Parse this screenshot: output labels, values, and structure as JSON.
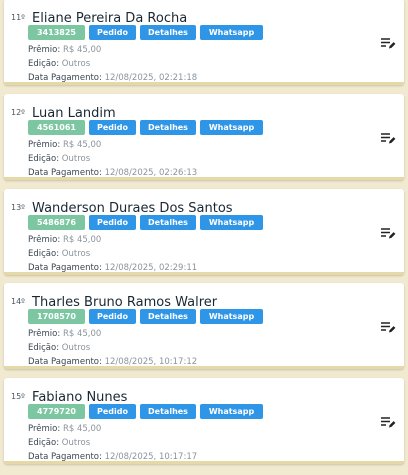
{
  "labels": {
    "premio": "Prêmio:",
    "edicao": "Edição:",
    "data_pagamento": "Data Pagamento:",
    "pedido": "Pedido",
    "detalhes": "Detalhes",
    "whatsapp": "Whatsapp"
  },
  "icons": {
    "edit": "edit-list-icon"
  },
  "colors": {
    "code_chip": "#7cc7a2",
    "button": "#2f95e6",
    "card_border": "#e6d9a8"
  },
  "winners": [
    {
      "position": "11º",
      "name": "Eliane Pereira Da Rocha",
      "code": "3413825",
      "premio": "R$ 45,00",
      "edicao": "Outros",
      "data_pagamento": "12/08/2025, 02:21:18"
    },
    {
      "position": "12º",
      "name": "Luan Landim",
      "code": "4561061",
      "premio": "R$ 45,00",
      "edicao": "Outros",
      "data_pagamento": "12/08/2025, 02:26:13"
    },
    {
      "position": "13º",
      "name": "Wanderson Duraes Dos Santos",
      "code": "5486876",
      "premio": "R$ 45,00",
      "edicao": "Outros",
      "data_pagamento": "12/08/2025, 02:29:11"
    },
    {
      "position": "14º",
      "name": "Tharles Bruno Ramos Walrer",
      "code": "1708570",
      "premio": "R$ 45,00",
      "edicao": "Outros",
      "data_pagamento": "12/08/2025, 10:17:12"
    },
    {
      "position": "15º",
      "name": "Fabiano Nunes",
      "code": "4779720",
      "premio": "R$ 45,00",
      "edicao": "Outros",
      "data_pagamento": "12/08/2025, 10:17:17"
    }
  ]
}
